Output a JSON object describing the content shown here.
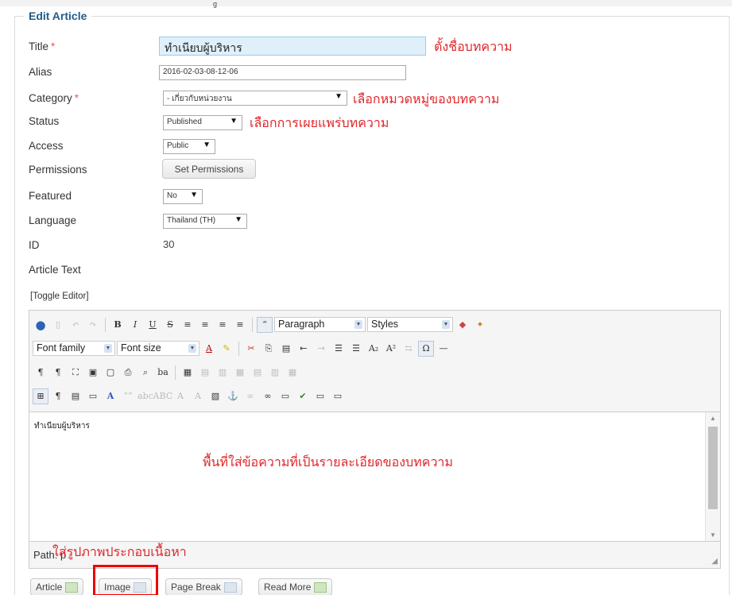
{
  "form": {
    "legend": "Edit Article",
    "fields": {
      "title_label": "Title",
      "required_mark": "*",
      "title_value": "ทำเนียบผู้บริหาร",
      "alias_label": "Alias",
      "alias_value": "2016-02-03-08-12-06",
      "category_label": "Category",
      "category_value": "- เกี่ยวกับหน่วยงาน",
      "status_label": "Status",
      "status_value": "Published",
      "access_label": "Access",
      "access_value": "Public",
      "permissions_label": "Permissions",
      "permissions_button": "Set Permissions",
      "featured_label": "Featured",
      "featured_value": "No",
      "language_label": "Language",
      "language_value": "Thailand (TH)",
      "id_label": "ID",
      "id_value": "30",
      "article_text_label": "Article Text"
    },
    "toggle_editor": "[Toggle Editor]"
  },
  "annotations": {
    "title": "ตั้งชื่อบทความ",
    "category": "เลือกหมวดหมู่ของบทความ",
    "status": "เลือกการเผยแพร่บทความ",
    "content": "พื้นที่ใส่ข้อความที่เป็นรายละเอียดของบทความ",
    "image": "ใส่รูปภาพประกอบเนื้อหา"
  },
  "editor": {
    "format_select": "Paragraph",
    "styles_select": "Styles",
    "font_family": "Font family",
    "font_size": "Font size",
    "content_text": "ทำเนียบผู้บริหาร",
    "path_label": "Path:",
    "path_value": "p"
  },
  "buttons": {
    "article": "Article",
    "image": "Image",
    "page_break": "Page Break",
    "read_more": "Read More"
  },
  "colors": {
    "legend": "#1f5c8b",
    "annotation": "#e0262a",
    "highlight_box": "#ee0000"
  }
}
